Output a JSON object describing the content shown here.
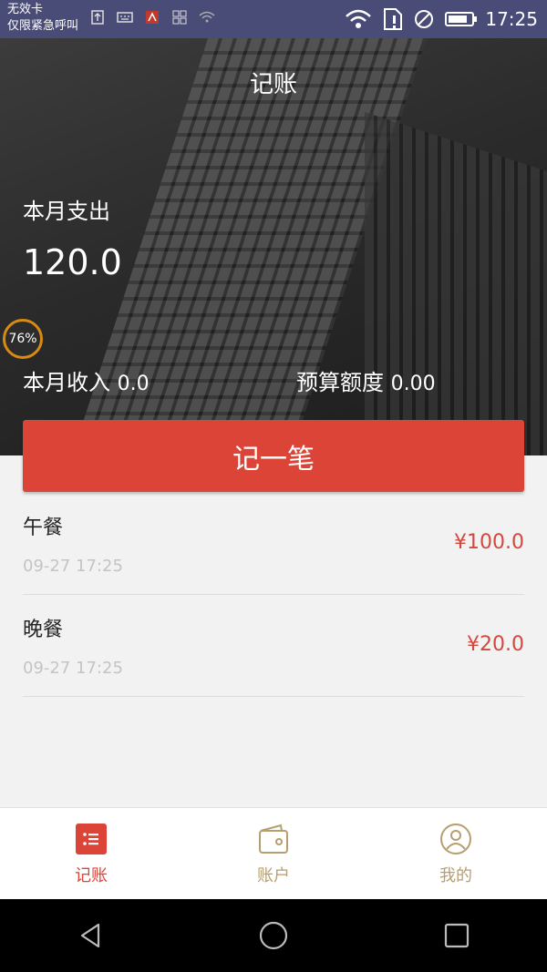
{
  "status_bar": {
    "carrier_line1": "无效卡",
    "carrier_line2": "仅限紧急呼叫",
    "time": "17:25"
  },
  "header": {
    "title": "记账",
    "month_expense_label": "本月支出",
    "month_expense_value": "120.0",
    "badge": "76%",
    "month_income_label": "本月收入",
    "month_income_value": "0.0",
    "budget_label": "预算额度",
    "budget_value": "0.00"
  },
  "add_button": {
    "label": "记一笔"
  },
  "entries": [
    {
      "name": "午餐",
      "time": "09-27 17:25",
      "amount": "¥100.0"
    },
    {
      "name": "晚餐",
      "time": "09-27 17:25",
      "amount": "¥20.0"
    }
  ],
  "tabs": [
    {
      "label": "记账",
      "icon": "list-icon",
      "active": true
    },
    {
      "label": "账户",
      "icon": "wallet-icon",
      "active": false
    },
    {
      "label": "我的",
      "icon": "user-icon",
      "active": false
    }
  ],
  "colors": {
    "accent": "#dd4438",
    "tab_inactive": "#b79e6e",
    "status_bar": "#4a4c78"
  }
}
